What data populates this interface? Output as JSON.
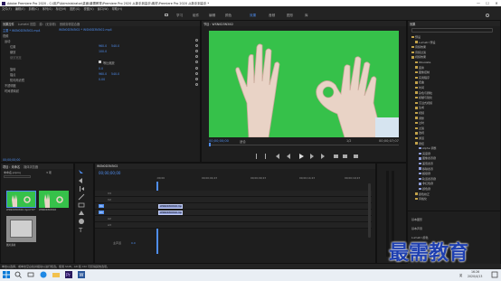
{
  "title_bar": {
    "text": "Adobe Premiere Pro 2020 - C:\\用户\\Administrator\\桌面\\最需教育\\Premiere Pro 2020 从新手到高手\\素材\\Premiere Pro 2020 从新手到高手 *",
    "min": "—",
    "max": "☐",
    "close": "✕"
  },
  "menu": [
    "文件(F)",
    "编辑(E)",
    "剪辑(C)",
    "序列(S)",
    "标记(M)",
    "图形(G)",
    "视图(V)",
    "窗口(W)",
    "帮助(H)"
  ],
  "workspaces": [
    "学习",
    "组件",
    "编辑",
    "颜色",
    "效果",
    "音频",
    "图形",
    "库"
  ],
  "workspace_active": "效果",
  "effect_controls": {
    "tabs": [
      "效果控件",
      "Lumetri 范围",
      "源：(无剪辑)",
      "音频剪辑混合器"
    ],
    "clip_label": "主要 * WSN0D3N3i02.mp4",
    "seq_label": "WSN0D3N3i02 * WSN0D3N3i02.mp4",
    "sections": {
      "video": "视频",
      "motion": "运动",
      "position": "位置",
      "position_x": "960.0",
      "position_y": "540.0",
      "scale": "缩放",
      "scale_val": "100.0",
      "scale_width": "缩放宽度",
      "uniform": "等比缩放",
      "rotation": "旋转",
      "rotation_val": "0.0",
      "anchor": "锚点",
      "anchor_x": "960.0",
      "anchor_y": "540.0",
      "flicker": "防闪烁滤镜",
      "flicker_val": "0.00",
      "opacity": "不透明度",
      "time_remap": "时间重映射"
    },
    "timecode": "00;00;00;00"
  },
  "program": {
    "tab": "节目：WSN0D3N3i02",
    "timecode_left": "00;00;00;00",
    "fit": "适合",
    "quality": "1/2",
    "timecode_right": "00;00;07;07"
  },
  "effects_panel": {
    "tab": "效果",
    "items": [
      "预设",
      "Lumetri 预设",
      "音频效果",
      "音频过渡",
      "视频效果",
      "Obsolete",
      "变换",
      "图像控制",
      "实用程序",
      "扭曲",
      "时间",
      "杂色与颗粒",
      "模糊与锐化",
      "沉浸式视频",
      "生成",
      "视频",
      "调整",
      "过时",
      "过渡",
      "透视",
      "通道",
      "键控",
      "Alpha 调整",
      "亮度键",
      "图像遮罩键",
      "差值遮罩",
      "移除遮罩",
      "超级键",
      "轨道遮罩键",
      "非红色键",
      "颜色键",
      "颜色校正",
      "风格化"
    ],
    "bottom_tabs": [
      "基本图形",
      "基本声音",
      "Lumetri 颜色",
      "库",
      "标记"
    ]
  },
  "project": {
    "tabs": [
      "项目：未命名",
      "媒体浏览器"
    ],
    "filename": "未命名.prproj",
    "count": "3 项",
    "clips": [
      {
        "name": "WSN0D3N3i02.mp4",
        "dur": "7;07"
      },
      {
        "name": "WSN0D3N3i02",
        "dur": "7;07"
      },
      {
        "name": "图片素材",
        "dur": ""
      }
    ]
  },
  "timeline": {
    "tab": "WSN0D3N3i02",
    "timecode": "00;00;00;00",
    "ruler": [
      ";00;00",
      "00;00;04;23",
      "00;00;09;23",
      "00;00;14;23",
      "00;00;19;23"
    ],
    "tracks": [
      "V3",
      "V2",
      "V1",
      "A1",
      "A2",
      "A3"
    ],
    "master": "主声道",
    "master_val": "0.0",
    "clip_video": "WSN0D3N3i02.mp4 [V]",
    "clip_audio": "WSN0D3N3i02.mp4"
  },
  "status": "单击以选择，或单击空白处并拖动以进行框选。使用 Shift、Alt 和 Ctrl 可获得其他选项。",
  "watermark": "最需教育",
  "taskbar": {
    "time": "16:26",
    "date": "2020/4/13",
    "lang": "英"
  },
  "colors": {
    "accent": "#4f8ef0",
    "green_screen": "#36c14a",
    "clip": "#8e9dd8"
  }
}
